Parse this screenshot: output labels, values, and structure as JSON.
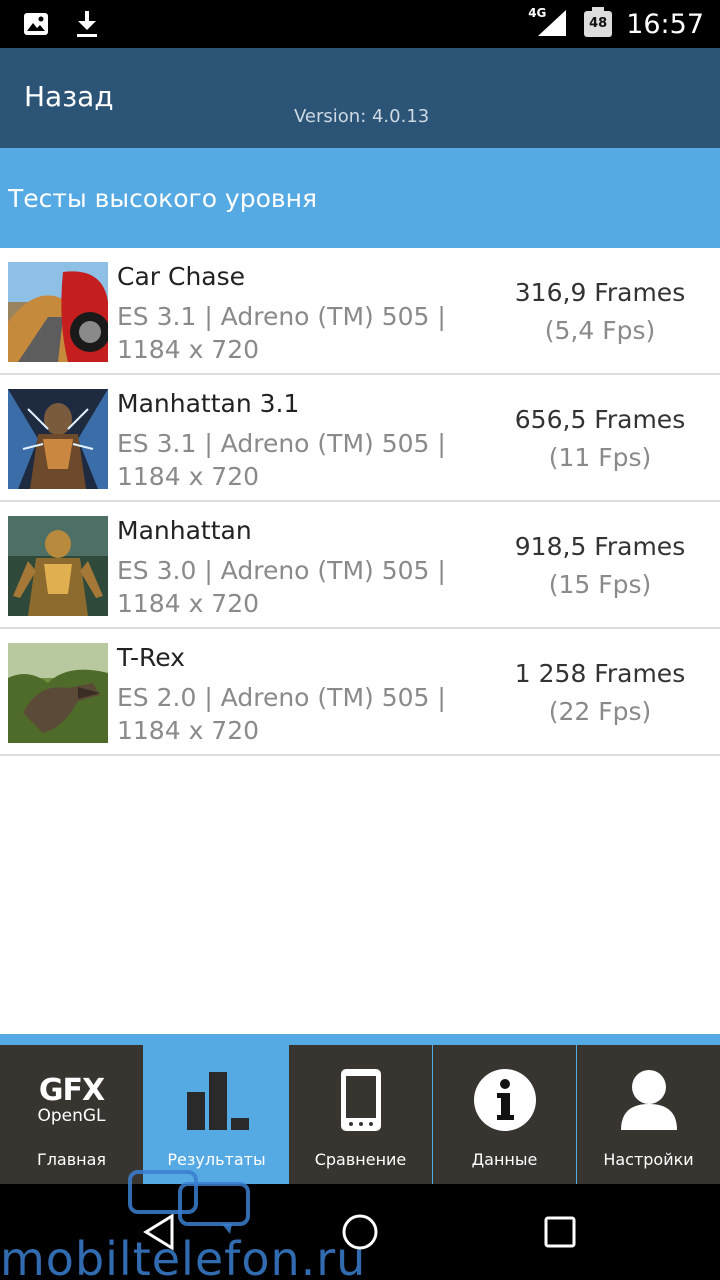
{
  "status_bar": {
    "time": "16:57",
    "network": "4G",
    "battery": "48",
    "icons": [
      "image-icon",
      "download-icon",
      "signal-icon",
      "battery-icon"
    ]
  },
  "header": {
    "back_label": "Назад",
    "version": "Version: 4.0.13"
  },
  "section": {
    "title": "Тесты высокого уровня"
  },
  "results": [
    {
      "name": "Car Chase",
      "desc": "ES 3.1 | Adreno (TM) 505 | 1184 x 720",
      "frames": "316,9 Frames",
      "fps": "(5,4 Fps)"
    },
    {
      "name": "Manhattan 3.1",
      "desc": "ES 3.1 | Adreno (TM) 505 | 1184 x 720",
      "frames": "656,5 Frames",
      "fps": "(11 Fps)"
    },
    {
      "name": "Manhattan",
      "desc": "ES 3.0 | Adreno (TM) 505 | 1184 x 720",
      "frames": "918,5 Frames",
      "fps": "(15 Fps)"
    },
    {
      "name": "T-Rex",
      "desc": "ES 2.0 | Adreno (TM) 505 | 1184 x 720",
      "frames": "1 258 Frames",
      "fps": "(22 Fps)"
    }
  ],
  "tabs": [
    {
      "label": "Главная",
      "logo_big": "GFX",
      "logo_small": "OpenGL",
      "icon": "gfx-logo-icon",
      "active": false
    },
    {
      "label": "Результаты",
      "icon": "bar-chart-icon",
      "active": true
    },
    {
      "label": "Сравнение",
      "icon": "phone-icon",
      "active": false
    },
    {
      "label": "Данные",
      "icon": "info-icon",
      "active": false
    },
    {
      "label": "Настройки",
      "icon": "user-icon",
      "active": false
    }
  ],
  "watermark": "mobiltelefon.ru",
  "colors": {
    "header": "#2b5476",
    "section": "#56aae4",
    "tab_bg": "#383530",
    "tab_active": "#56aae4",
    "watermark": "#3a7fd0"
  }
}
